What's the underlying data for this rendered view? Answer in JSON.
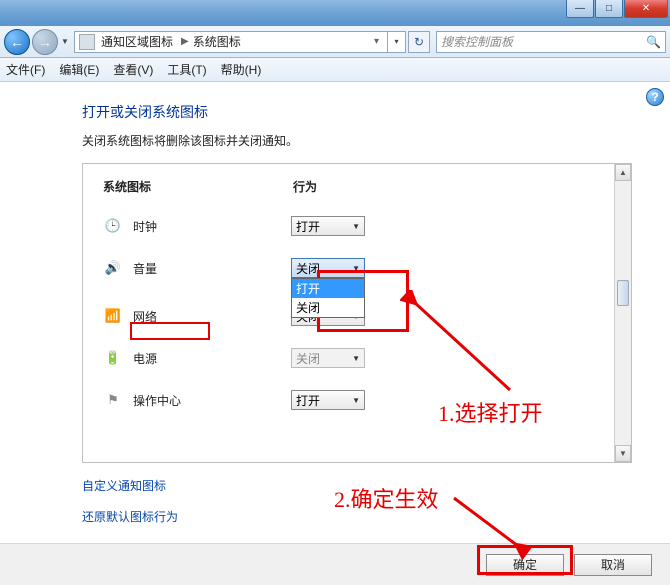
{
  "window": {
    "minimize": "—",
    "maximize": "□",
    "close": "✕"
  },
  "nav": {
    "back": "←",
    "forward": "→",
    "crumbs": [
      "通知区域图标",
      "系统图标"
    ],
    "refresh": "↻"
  },
  "search": {
    "placeholder": "搜索控制面板",
    "icon": "🔍"
  },
  "menu": {
    "file": "文件(F)",
    "edit": "编辑(E)",
    "view": "查看(V)",
    "tools": "工具(T)",
    "help": "帮助(H)"
  },
  "help_icon": "?",
  "page": {
    "title": "打开或关闭系统图标",
    "desc": "关闭系统图标将删除该图标并关闭通知。"
  },
  "columns": {
    "c1": "系统图标",
    "c2": "行为"
  },
  "rows": [
    {
      "icon": "clock-icon",
      "glyph": "🕒",
      "label": "时钟",
      "value": "打开",
      "disabled": false
    },
    {
      "icon": "volume-icon",
      "glyph": "🔊",
      "label": "音量",
      "value": "关闭",
      "disabled": false,
      "open": true
    },
    {
      "icon": "network-icon",
      "glyph": "📶",
      "label": "网络",
      "value": "关闭",
      "disabled": false
    },
    {
      "icon": "power-icon",
      "glyph": "🔋",
      "label": "电源",
      "value": "关闭",
      "disabled": true
    },
    {
      "icon": "flag-icon",
      "glyph": "⚑",
      "label": "操作中心",
      "value": "打开",
      "disabled": false
    }
  ],
  "dropdown_options": {
    "open": "打开",
    "close": "关闭"
  },
  "links": {
    "customize": "自定义通知图标",
    "restore": "还原默认图标行为"
  },
  "buttons": {
    "ok": "确定",
    "cancel": "取消"
  },
  "annotations": {
    "a1": "1.选择打开",
    "a2": "2.确定生效"
  }
}
